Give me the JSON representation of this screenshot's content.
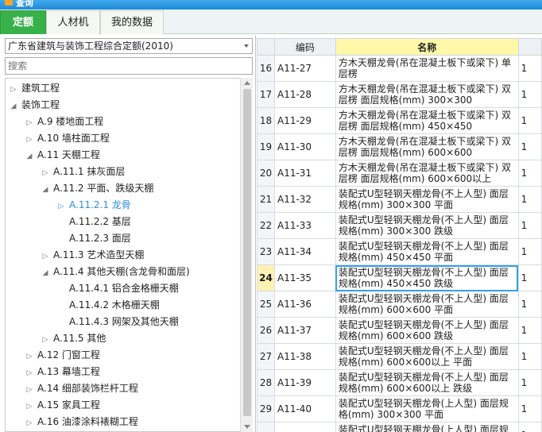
{
  "window": {
    "title": "查询"
  },
  "tabs": [
    {
      "label": "定额",
      "active": true
    },
    {
      "label": "人材机",
      "active": false
    },
    {
      "label": "我的数据",
      "active": false
    }
  ],
  "left_panel": {
    "quota_selector": "广东省建筑与装饰工程综合定额(2010)",
    "search_placeholder": "搜索",
    "tree": [
      {
        "label": "建筑工程",
        "level": 0,
        "expanded": false
      },
      {
        "label": "装饰工程",
        "level": 0,
        "expanded": true
      },
      {
        "label": "A.9 楼地面工程",
        "level": 1,
        "expanded": false
      },
      {
        "label": "A.10 墙柱面工程",
        "level": 1,
        "expanded": false
      },
      {
        "label": "A.11 天棚工程",
        "level": 1,
        "expanded": true
      },
      {
        "label": "A.11.1 抹灰面层",
        "level": 2,
        "expanded": false
      },
      {
        "label": "A.11.2 平面、跌级天棚",
        "level": 2,
        "expanded": true
      },
      {
        "label": "A.11.2.1 龙骨",
        "level": 3,
        "expanded": false,
        "selected": true
      },
      {
        "label": "A.11.2.2 基层",
        "level": 3,
        "leaf": true
      },
      {
        "label": "A.11.2.3 面层",
        "level": 3,
        "leaf": true
      },
      {
        "label": "A.11.3 艺术造型天棚",
        "level": 2,
        "expanded": false
      },
      {
        "label": "A.11.4 其他天棚(含龙骨和面层)",
        "level": 2,
        "expanded": true
      },
      {
        "label": "A.11.4.1 铝合金格栅天棚",
        "level": 3,
        "leaf": true
      },
      {
        "label": "A.11.4.2 木格栅天棚",
        "level": 3,
        "leaf": true
      },
      {
        "label": "A.11.4.3 网架及其他天棚",
        "level": 3,
        "leaf": true
      },
      {
        "label": "A.11.5 其他",
        "level": 2,
        "expanded": false
      },
      {
        "label": "A.12 门窗工程",
        "level": 1,
        "expanded": false
      },
      {
        "label": "A.13 幕墙工程",
        "level": 1,
        "expanded": false
      },
      {
        "label": "A.14 细部装饰栏杆工程",
        "level": 1,
        "expanded": false
      },
      {
        "label": "A.15 家具工程",
        "level": 1,
        "expanded": false
      },
      {
        "label": "A.16 油漆涂料裱糊工程",
        "level": 1,
        "expanded": false
      }
    ]
  },
  "grid": {
    "columns": [
      "编码",
      "名称"
    ],
    "current_row": "24",
    "rows": [
      {
        "num": "16",
        "code": "A11-27",
        "name": "方木天棚龙骨(吊在混凝土板下或梁下) 单层楞",
        "unit": "1"
      },
      {
        "num": "17",
        "code": "A11-28",
        "name": "方木天棚龙骨(吊在混凝土板下或梁下) 双层楞 面层规格(mm) 300×300",
        "unit": "1"
      },
      {
        "num": "18",
        "code": "A11-29",
        "name": "方木天棚龙骨(吊在混凝土板下或梁下) 双层楞 面层规格(mm) 450×450",
        "unit": "1"
      },
      {
        "num": "19",
        "code": "A11-30",
        "name": "方木天棚龙骨(吊在混凝土板下或梁下) 双层楞 面层规格(mm) 600×600",
        "unit": "1"
      },
      {
        "num": "20",
        "code": "A11-31",
        "name": "方木天棚龙骨(吊在混凝土板下或梁下) 双层楞 面层规格(mm) 600×600以上",
        "unit": "1"
      },
      {
        "num": "21",
        "code": "A11-32",
        "name": "装配式U型轻钢天棚龙骨(不上人型) 面层规格(mm) 300×300 平面",
        "unit": "1"
      },
      {
        "num": "22",
        "code": "A11-33",
        "name": "装配式U型轻钢天棚龙骨(不上人型) 面层规格(mm) 300×300 跌级",
        "unit": "1"
      },
      {
        "num": "23",
        "code": "A11-34",
        "name": "装配式U型轻钢天棚龙骨(不上人型) 面层规格(mm) 450×450 平面",
        "unit": "1"
      },
      {
        "num": "24",
        "code": "A11-35",
        "name": "装配式U型轻钢天棚龙骨(不上人型) 面层规格(mm) 450×450 跌级",
        "unit": "1"
      },
      {
        "num": "25",
        "code": "A11-36",
        "name": "装配式U型轻钢天棚龙骨(不上人型) 面层规格(mm) 600×600 平面",
        "unit": "1"
      },
      {
        "num": "26",
        "code": "A11-37",
        "name": "装配式U型轻钢天棚龙骨(不上人型) 面层规格(mm) 600×600 跌级",
        "unit": "1"
      },
      {
        "num": "27",
        "code": "A11-38",
        "name": "装配式U型轻钢天棚龙骨(不上人型) 面层规格(mm) 600×600以上 平面",
        "unit": "1"
      },
      {
        "num": "28",
        "code": "A11-39",
        "name": "装配式U型轻钢天棚龙骨(不上人型) 面层规格(mm) 600×600以上 跌级",
        "unit": "1"
      },
      {
        "num": "29",
        "code": "A11-40",
        "name": "装配式U型轻钢天棚龙骨(上人型) 面层规格(mm) 300×300 平面",
        "unit": "1"
      },
      {
        "num": "",
        "code": "",
        "name": "装配式U型轻钢天棚龙骨(上人型) 面层规格",
        "unit": "1"
      }
    ]
  },
  "colors": {
    "tab_active": "#37b24a",
    "header_name_bg": "#fff8a8",
    "selection_blue": "#2d8ee0",
    "titlebar": "#1e8ad6"
  }
}
